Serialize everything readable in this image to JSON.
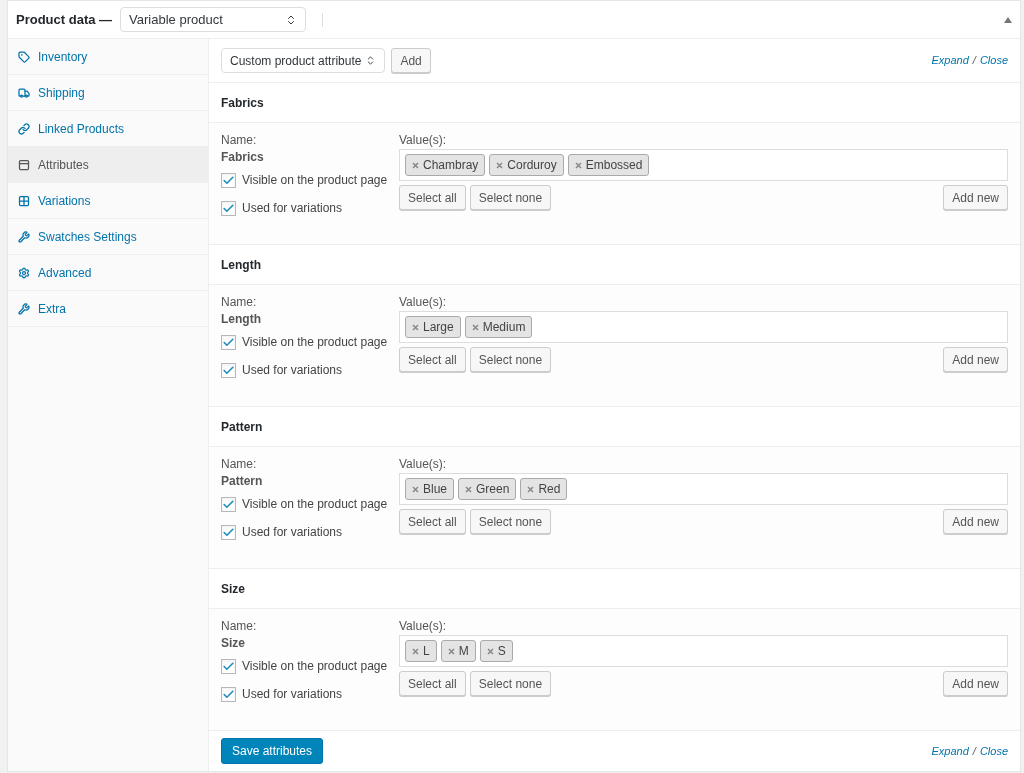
{
  "header": {
    "title": "Product data —",
    "product_type": "Variable product"
  },
  "sidebar": {
    "items": [
      {
        "label": "Inventory",
        "kind": "tag",
        "selected": false
      },
      {
        "label": "Shipping",
        "kind": "truck",
        "selected": false
      },
      {
        "label": "Linked Products",
        "kind": "link",
        "selected": false
      },
      {
        "label": "Attributes",
        "kind": "table",
        "selected": true
      },
      {
        "label": "Variations",
        "kind": "grid",
        "selected": false
      },
      {
        "label": "Swatches Settings",
        "kind": "wrench",
        "selected": false
      },
      {
        "label": "Advanced",
        "kind": "gear",
        "selected": false
      },
      {
        "label": "Extra",
        "kind": "wrench",
        "selected": false
      }
    ]
  },
  "toolbar": {
    "attribute_select": "Custom product attribute",
    "add_button": "Add",
    "expand": "Expand",
    "separator": "/",
    "close": "Close"
  },
  "attributes": [
    {
      "title": "Fabrics",
      "name_label": "Name:",
      "name": "Fabrics",
      "values_label": "Value(s):",
      "values": [
        "Chambray",
        "Corduroy",
        "Embossed"
      ],
      "visible_label": "Visible on the product page",
      "visible": true,
      "variations_label": "Used for variations",
      "used_for_variations": true,
      "select_all": "Select all",
      "select_none": "Select none",
      "add_new": "Add new"
    },
    {
      "title": "Length",
      "name_label": "Name:",
      "name": "Length",
      "values_label": "Value(s):",
      "values": [
        "Large",
        "Medium"
      ],
      "visible_label": "Visible on the product page",
      "visible": true,
      "variations_label": "Used for variations",
      "used_for_variations": true,
      "select_all": "Select all",
      "select_none": "Select none",
      "add_new": "Add new"
    },
    {
      "title": "Pattern",
      "name_label": "Name:",
      "name": "Pattern",
      "values_label": "Value(s):",
      "values": [
        "Blue",
        "Green",
        "Red"
      ],
      "visible_label": "Visible on the product page",
      "visible": true,
      "variations_label": "Used for variations",
      "used_for_variations": true,
      "select_all": "Select all",
      "select_none": "Select none",
      "add_new": "Add new"
    },
    {
      "title": "Size",
      "name_label": "Name:",
      "name": "Size",
      "values_label": "Value(s):",
      "values": [
        "L",
        "M",
        "S"
      ],
      "visible_label": "Visible on the product page",
      "visible": true,
      "variations_label": "Used for variations",
      "used_for_variations": true,
      "select_all": "Select all",
      "select_none": "Select none",
      "add_new": "Add new"
    }
  ],
  "footer": {
    "save_button": "Save attributes",
    "expand": "Expand",
    "separator": "/",
    "close": "Close"
  }
}
